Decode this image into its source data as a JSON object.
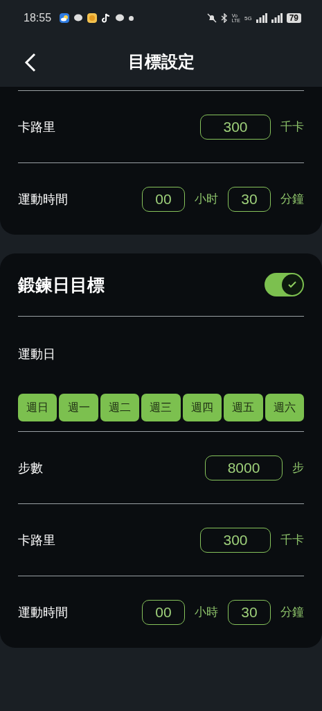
{
  "status_bar": {
    "time": "18:55",
    "volte_top": "Vo",
    "volte_bottom": "LTE",
    "network": "5G",
    "battery": "79"
  },
  "header": {
    "title": "目標設定"
  },
  "sections": [
    {
      "rows": [
        {
          "kind": "single",
          "label": "卡路里",
          "value": "300",
          "unit": "千卡"
        },
        {
          "kind": "duration",
          "label": "運動時間",
          "hours": "00",
          "hours_unit": "小时",
          "minutes": "30",
          "minutes_unit": "分鐘"
        }
      ]
    },
    {
      "title": "鍛鍊日目標",
      "enabled": true,
      "days_label": "運動日",
      "days": [
        {
          "label": "週日",
          "selected": true
        },
        {
          "label": "週一",
          "selected": true
        },
        {
          "label": "週二",
          "selected": true
        },
        {
          "label": "週三",
          "selected": true
        },
        {
          "label": "週四",
          "selected": true
        },
        {
          "label": "週五",
          "selected": true
        },
        {
          "label": "週六",
          "selected": true
        }
      ],
      "rows": [
        {
          "kind": "single",
          "label": "步數",
          "value": "8000",
          "unit": "步"
        },
        {
          "kind": "single",
          "label": "卡路里",
          "value": "300",
          "unit": "千卡"
        },
        {
          "kind": "duration",
          "label": "運動時間",
          "hours": "00",
          "hours_unit": "小時",
          "minutes": "30",
          "minutes_unit": "分鐘"
        }
      ]
    }
  ]
}
